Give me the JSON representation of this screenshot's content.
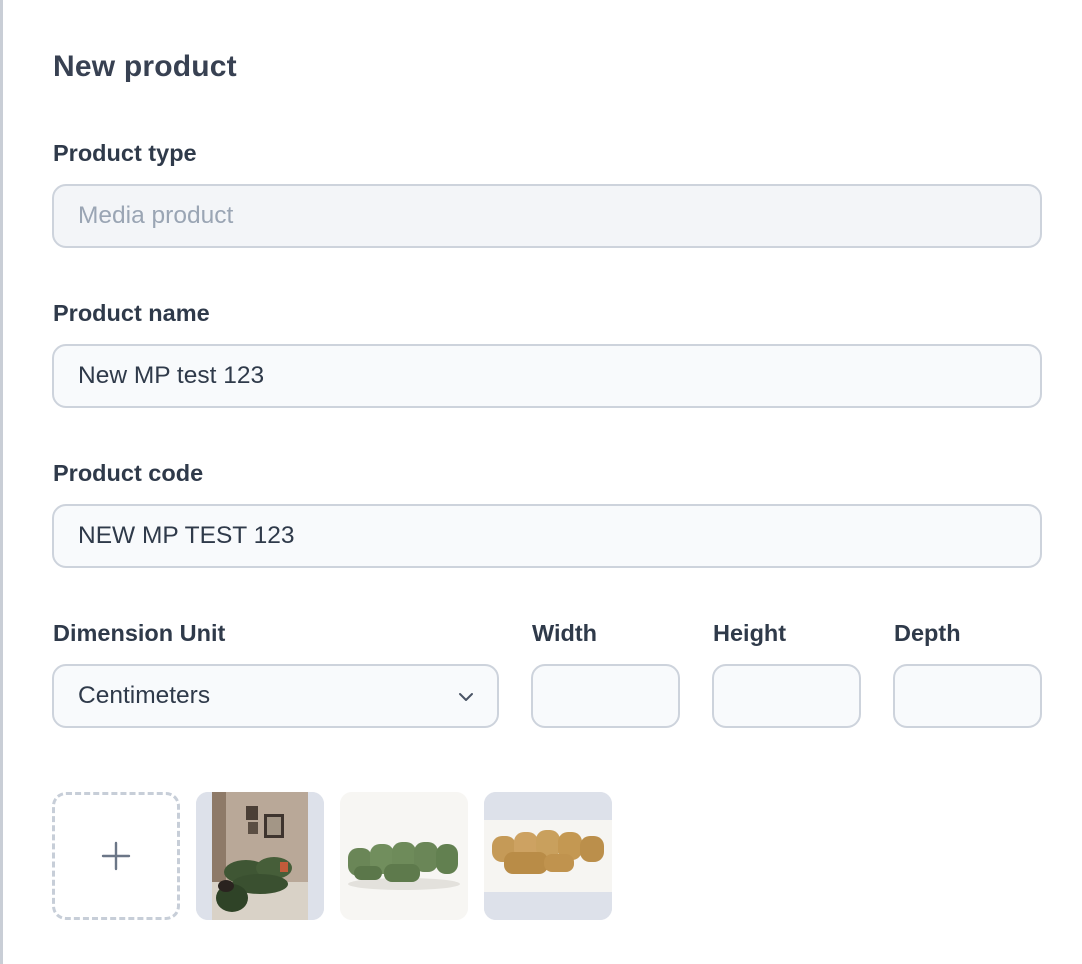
{
  "dialog": {
    "title": "New product"
  },
  "form": {
    "product_type": {
      "label": "Product type",
      "placeholder": "Media product"
    },
    "product_name": {
      "label": "Product name",
      "value": "New MP test 123"
    },
    "product_code": {
      "label": "Product code",
      "value": "NEW MP TEST 123"
    },
    "dimension_unit": {
      "label": "Dimension Unit",
      "value": "Centimeters"
    },
    "width": {
      "label": "Width",
      "value": ""
    },
    "height": {
      "label": "Height",
      "value": ""
    },
    "depth": {
      "label": "Depth",
      "value": ""
    }
  },
  "media": {
    "add_icon": "plus-icon",
    "thumbnails": [
      {
        "name": "green-sofa-room-photo"
      },
      {
        "name": "green-modular-sofa-photo"
      },
      {
        "name": "ochre-modular-sofa-photo"
      }
    ]
  },
  "colors": {
    "border": "#cdd3dc",
    "field_bg": "#f8fafc",
    "thumb_bg": "#dde1ea",
    "text": "#2f3a4a"
  }
}
